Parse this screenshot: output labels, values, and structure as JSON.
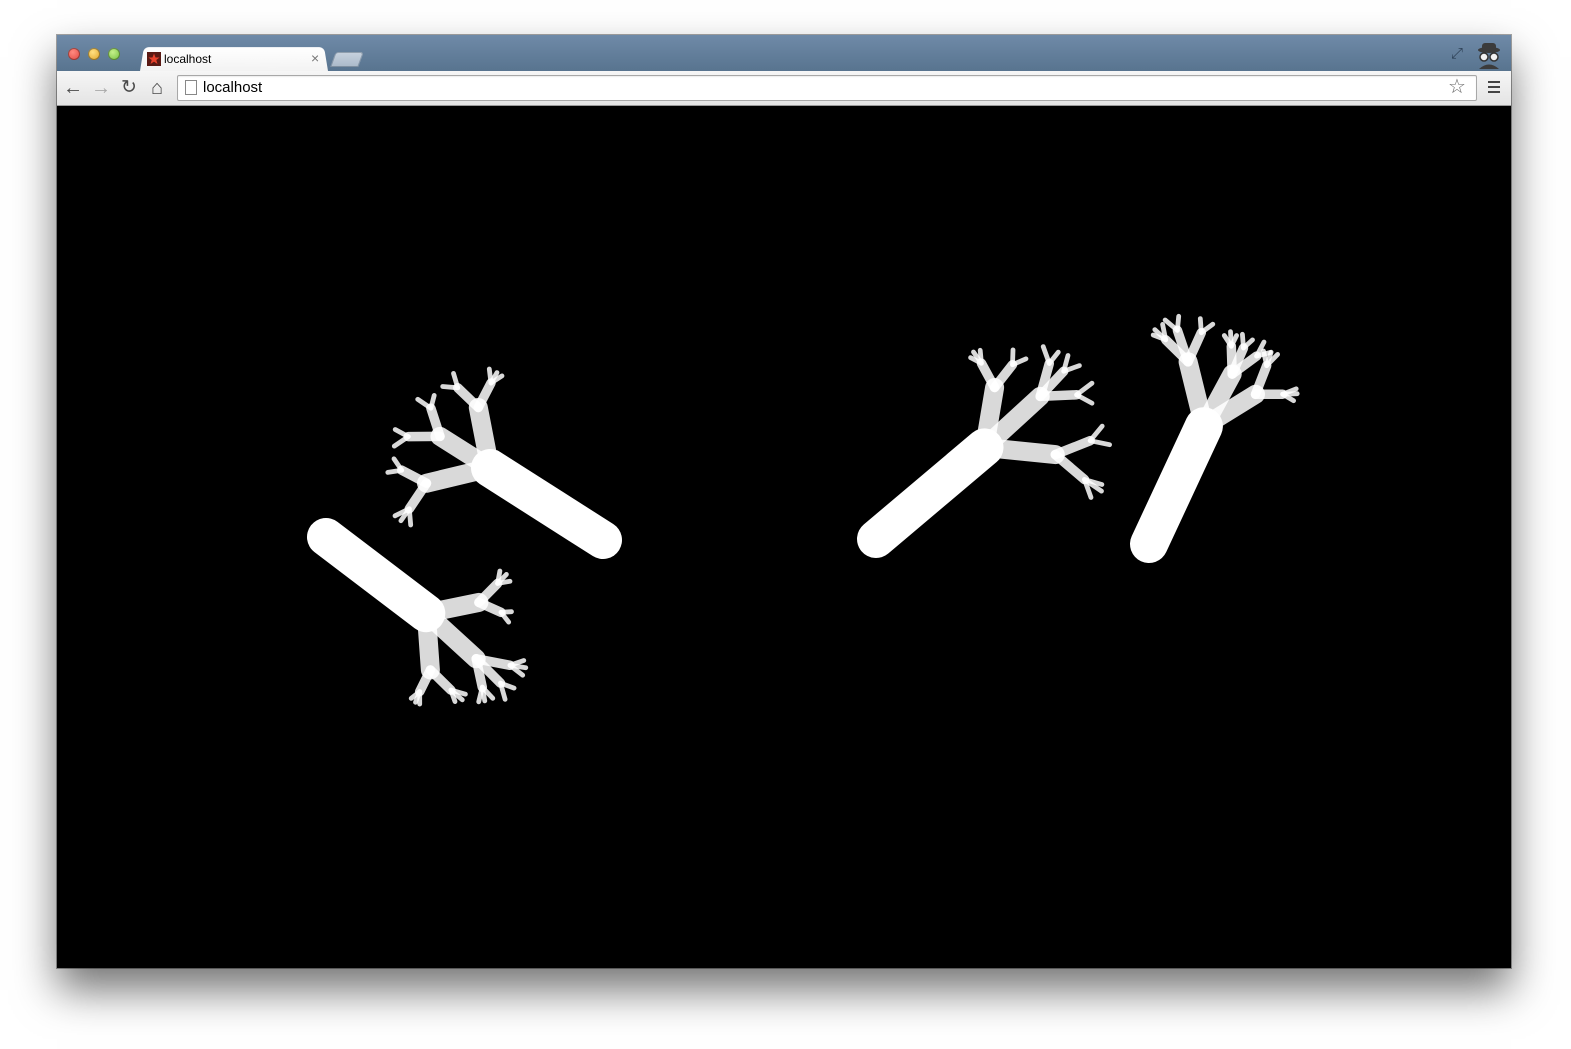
{
  "browser": {
    "tab": {
      "title": "localhost",
      "close_glyph": "×"
    },
    "address_bar": {
      "url": "localhost"
    },
    "nav": {
      "back_glyph": "←",
      "forward_glyph": "→",
      "reload_glyph": "↻",
      "home_glyph": "⌂",
      "star_glyph": "☆",
      "fullscreen_glyph": "⤢"
    },
    "icons": [
      "close-icon",
      "minimize-icon",
      "zoom-icon",
      "favicon",
      "new-tab-icon",
      "fullscreen-icon",
      "incognito-icon",
      "back-icon",
      "forward-icon",
      "reload-icon",
      "home-icon",
      "page-icon",
      "star-icon",
      "menu-icon"
    ]
  },
  "canvas": {
    "background": "#000000",
    "stroke": "#ffffff",
    "description_of_content": ""
  }
}
